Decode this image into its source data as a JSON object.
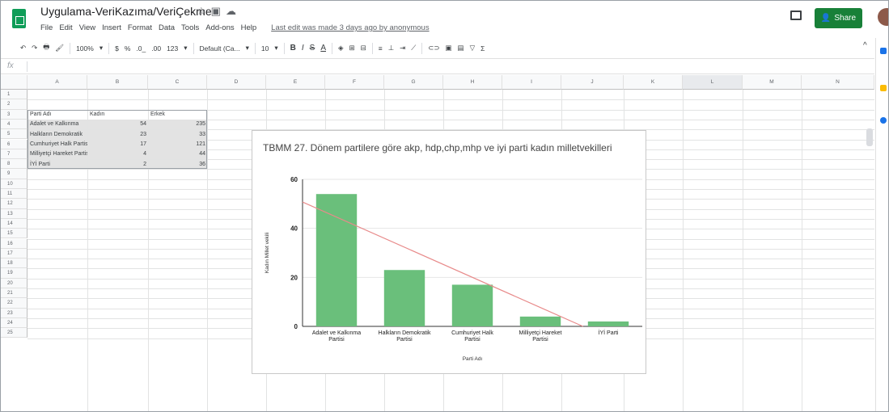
{
  "app": {
    "doc_title": "Uygulama-VeriKazıma/VeriÇekme",
    "title_icons": [
      "star-icon",
      "folder-icon",
      "cloud-icon"
    ],
    "menu": [
      "File",
      "Edit",
      "View",
      "Insert",
      "Format",
      "Data",
      "Tools",
      "Add-ons",
      "Help"
    ],
    "last_edit": "Last edit was made 3 days ago by anonymous",
    "share_label": "Share",
    "brand_color": "#0f9d58",
    "share_color": "#188038"
  },
  "toolbar": {
    "undo": "↶",
    "redo": "↷",
    "print": "🖶",
    "paint_format": "🖌",
    "zoom": "100%",
    "currency": "$",
    "percent": "%",
    "decrease_decimal": ".0_",
    "increase_decimal": ".00",
    "more_formats": "123",
    "font": "Default (Ca...",
    "font_size": "10",
    "bold": "B",
    "italic": "I",
    "strikethrough": "S",
    "text_color": "A",
    "collapse": "^"
  },
  "sheet": {
    "columns": [
      "A",
      "B",
      "C",
      "D",
      "E",
      "F",
      "G",
      "H",
      "I",
      "J",
      "K",
      "L",
      "M",
      "N"
    ],
    "rows": [
      "1",
      "2",
      "3",
      "4",
      "5",
      "6",
      "7",
      "8",
      "9",
      "10",
      "11",
      "12",
      "13",
      "14",
      "15",
      "16",
      "17",
      "18",
      "19",
      "20",
      "21",
      "22",
      "23",
      "24",
      "25"
    ],
    "headers": [
      "Parti Adı",
      "Kadın",
      "Erkek"
    ],
    "data": [
      {
        "name": "Adalet ve Kalkınma",
        "kadin": "54",
        "erkek": "235"
      },
      {
        "name": "Halkların Demokratik",
        "kadin": "23",
        "erkek": "33"
      },
      {
        "name": "Cumhuriyet Halk Partisi",
        "kadin": "17",
        "erkek": "121"
      },
      {
        "name": "Milliyetçi Hareket Partisi",
        "kadin": "4",
        "erkek": "44"
      },
      {
        "name": "İYİ Parti",
        "kadin": "2",
        "erkek": "36"
      }
    ]
  },
  "chart_data": {
    "type": "bar",
    "title": "TBMM 27. Dönem partilere göre akp, hdp,chp,mhp ve iyi parti kadın milletvekilleri",
    "categories": [
      "Adalet ve Kalkınma Partisi",
      "Halkların Demokratik Partisi",
      "Cumhuriyet Halk Partisi",
      "Milliyetçi Hareket Partisi",
      "İYİ Parti"
    ],
    "values": [
      54,
      23,
      17,
      4,
      2
    ],
    "xlabel": "Parti Adı",
    "ylabel": "Kadın Millet vekili",
    "ylim": [
      0,
      60
    ],
    "yticks": [
      "0",
      "20",
      "40",
      "60"
    ],
    "trendline": true,
    "grid": true,
    "bar_color": "#6abf7b",
    "trend_color": "#e88a8a"
  }
}
